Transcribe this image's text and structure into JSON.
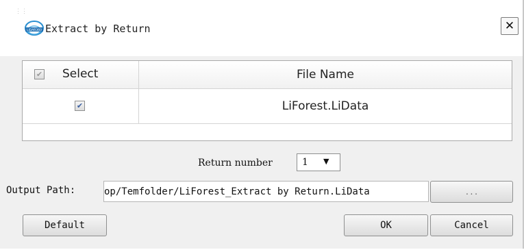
{
  "window": {
    "title": "Extract by Return",
    "close_label": "✕",
    "logo_icon": "liforest-logo-icon"
  },
  "table": {
    "columns": [
      "Select",
      "File Name"
    ],
    "header_checked": true,
    "rows": [
      {
        "checked": true,
        "file_name": "LiForest.LiData"
      }
    ]
  },
  "return_number": {
    "label": "Return number",
    "value": "1",
    "arrow": "▼"
  },
  "output_path": {
    "label": "Output Path:",
    "value": "op/Temfolder/LiForest_Extract by Return.LiData",
    "browse_label": "..."
  },
  "buttons": {
    "default": "Default",
    "ok": "OK",
    "cancel": "Cancel"
  },
  "check_glyph": "✔"
}
